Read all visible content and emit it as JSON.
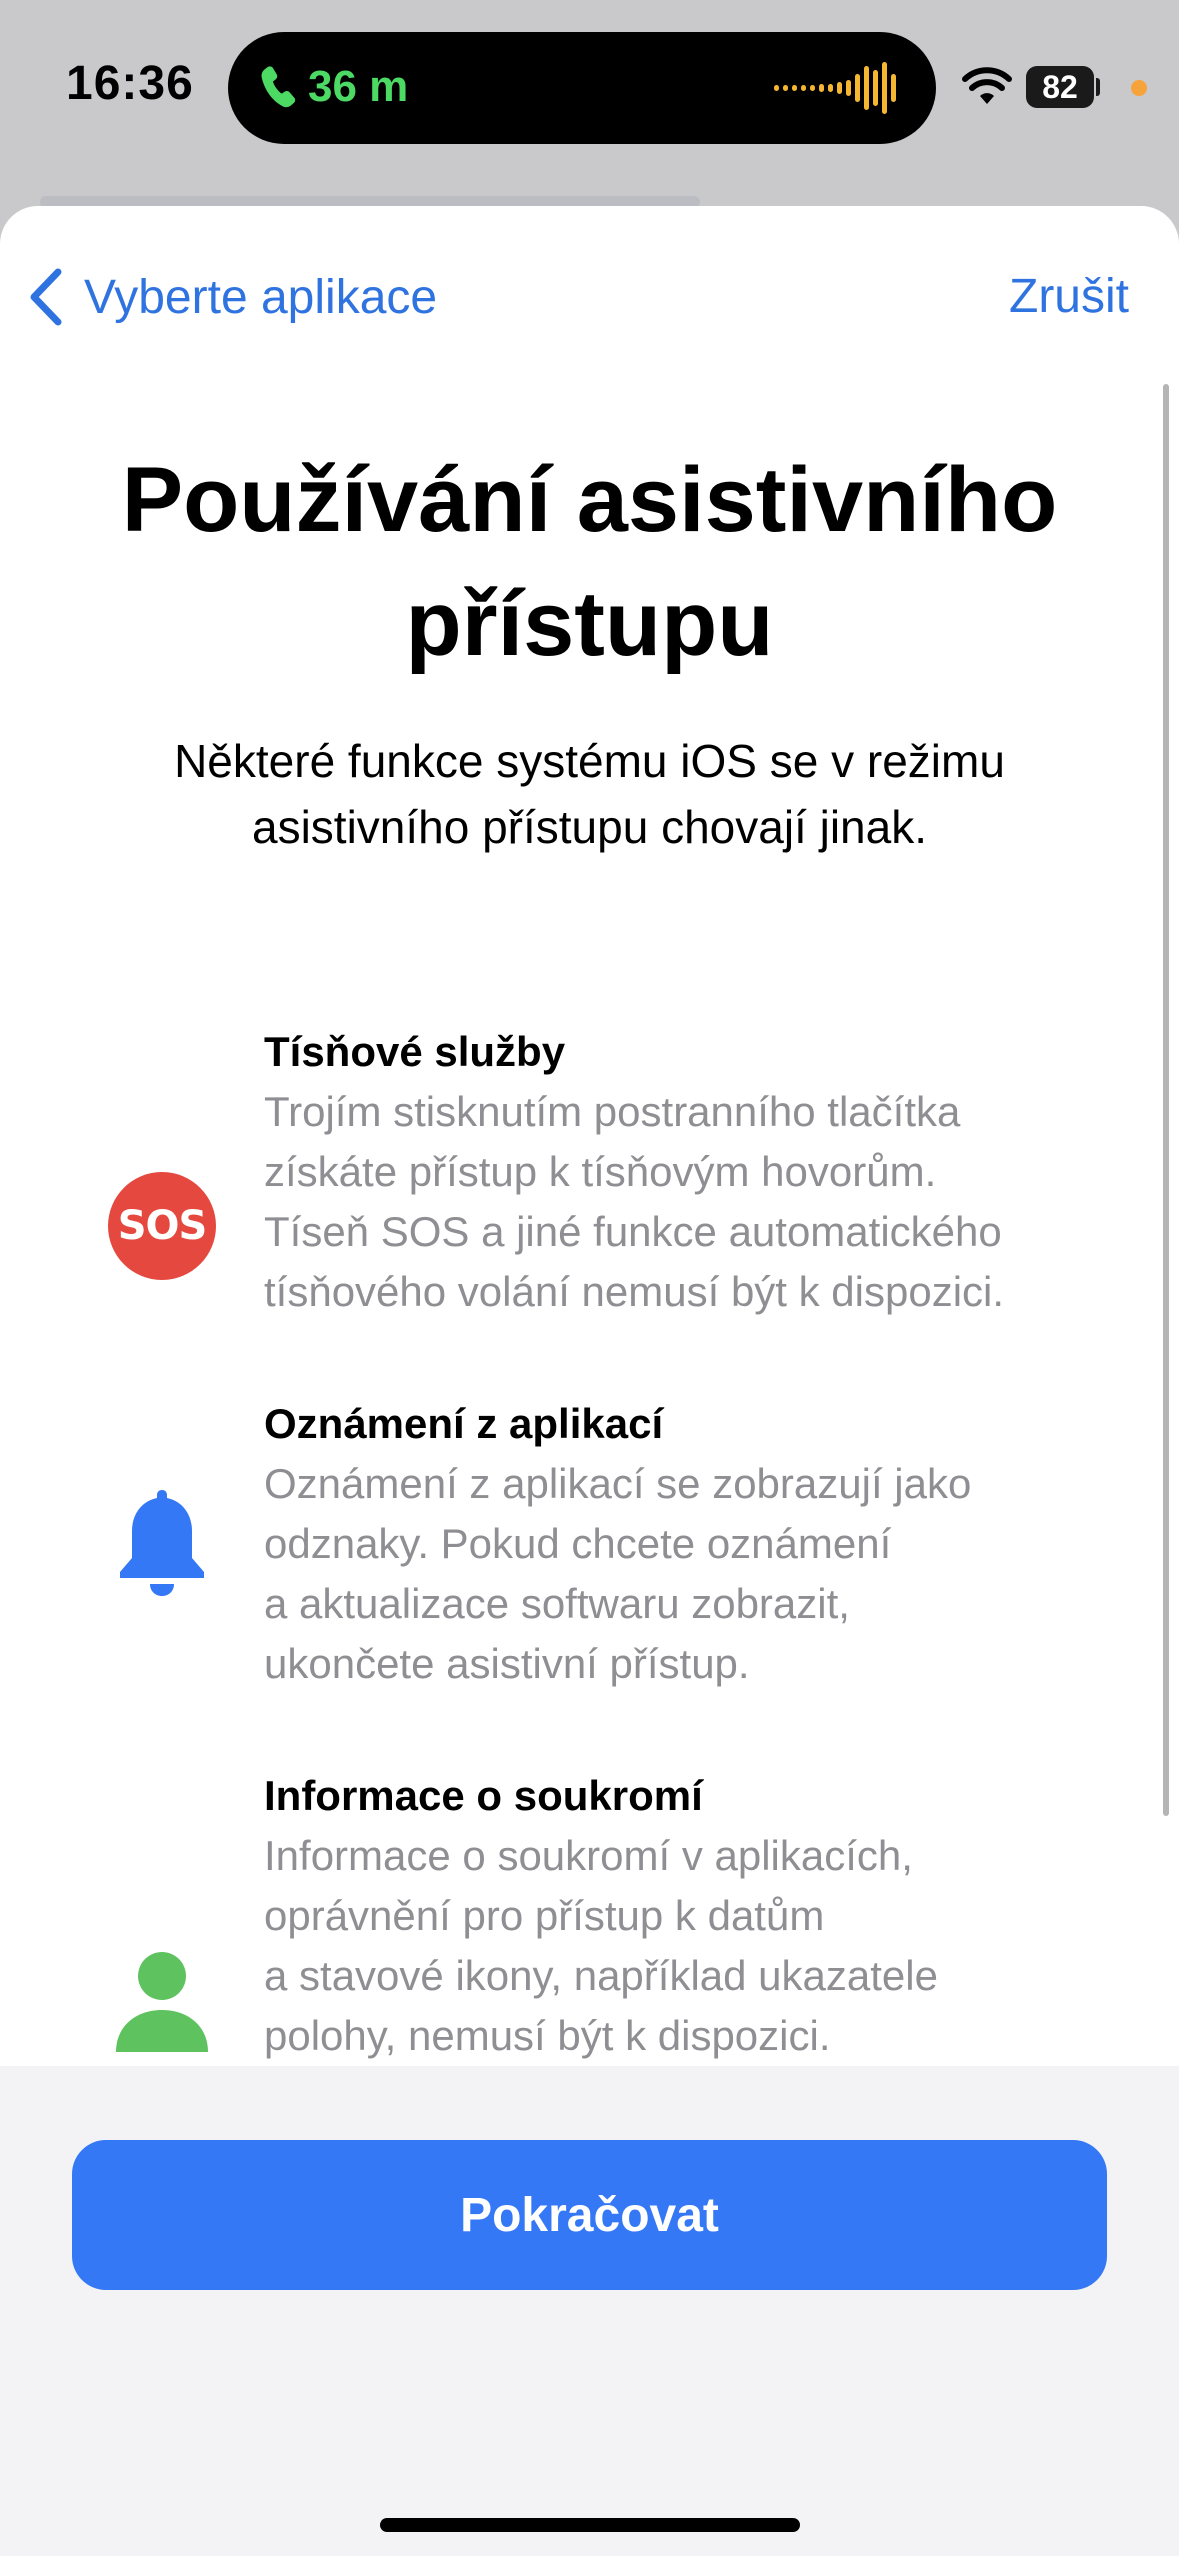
{
  "status_bar": {
    "time": "16:36",
    "call_duration": "36 m",
    "battery_level": "82",
    "call_color": "#4cd964",
    "privacy_indicator_color": "#f7a33b"
  },
  "nav": {
    "back_label": "Vyberte aplikace",
    "cancel_label": "Zrušit",
    "accent_color": "#2f73e0"
  },
  "header": {
    "title": "Používání asistivního přístupu",
    "subtitle": "Některé funkce systému iOS se v režimu asistivního přístupu chovají jinak."
  },
  "features": [
    {
      "icon": "sos-icon",
      "icon_text": "SOS",
      "icon_color": "#e5483f",
      "title": "Tísňové služby",
      "description_lines": [
        "Trojím stisknutím postranního tlačítka",
        "získáte přístup k tísňovým hovorům.",
        "Tíseň SOS a jiné funkce automatického",
        "tísňového volání nemusí být k dispozici."
      ]
    },
    {
      "icon": "bell-icon",
      "icon_color": "#3478f6",
      "title": "Oznámení z aplikací",
      "description_lines": [
        "Oznámení z aplikací se zobrazují jako",
        "odznaky. Pokud chcete oznámení",
        "a aktualizace softwaru zobrazit,",
        "ukončete asistivní přístup."
      ]
    },
    {
      "icon": "person-icon",
      "icon_color": "#5ec35f",
      "title": "Informace o soukromí",
      "description_lines": [
        "Informace o soukromí v aplikacích,",
        "oprávnění pro přístup k datům",
        "a stavové ikony, například ukazatele",
        "polohy, nemusí být k dispozici."
      ]
    }
  ],
  "footer": {
    "continue_label": "Pokračovat",
    "button_color": "#3478f6"
  }
}
